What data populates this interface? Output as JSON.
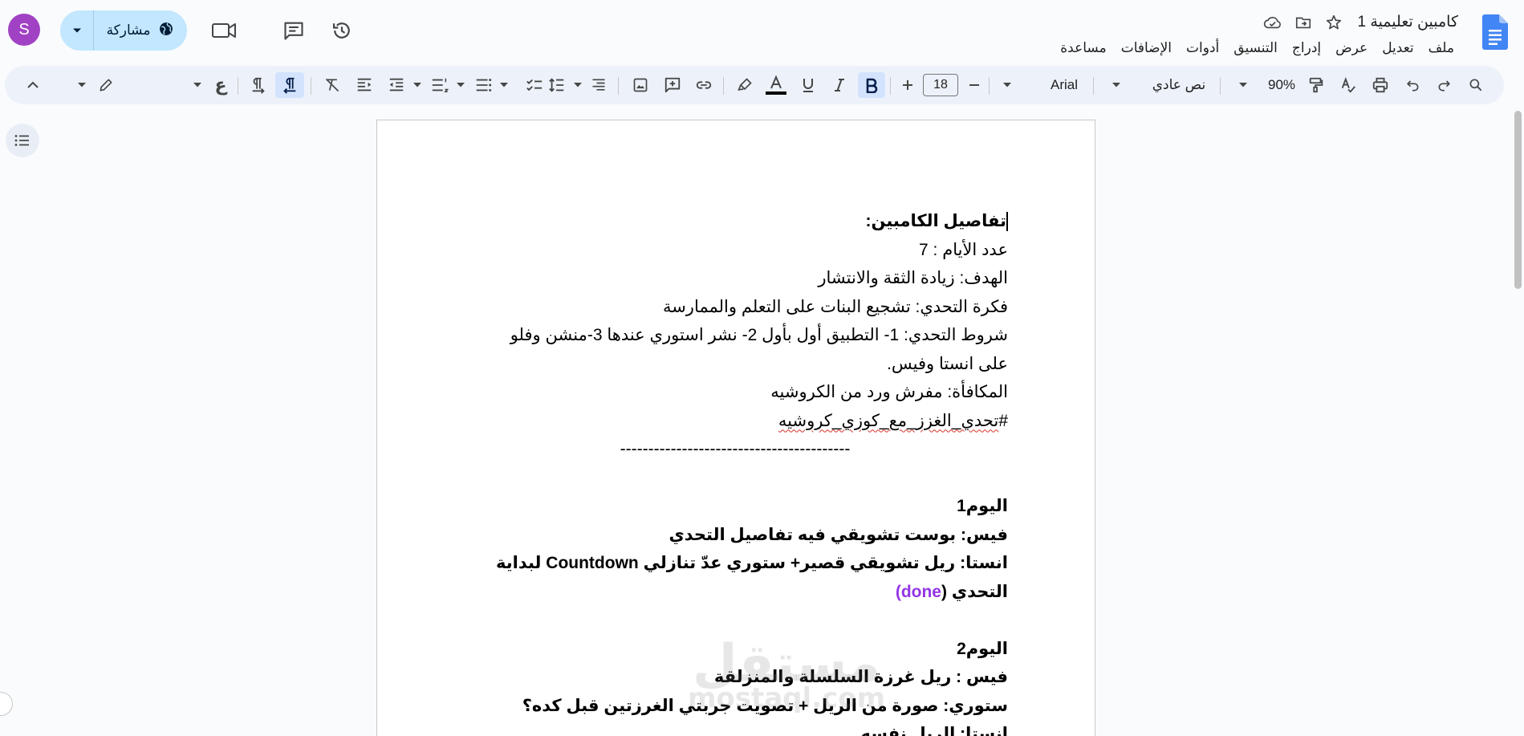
{
  "doc": {
    "title": "كامبين تعليمية 1",
    "menus": [
      "ملف",
      "تعديل",
      "عرض",
      "إدراج",
      "التنسيق",
      "أدوات",
      "الإضافات",
      "مساعدة"
    ]
  },
  "header": {
    "avatar_letter": "S",
    "share_label": "مشاركة"
  },
  "toolbar": {
    "zoom": "90%",
    "style": "نص عادي",
    "font": "Arial",
    "font_size": "18",
    "ain_glyph": "ع"
  },
  "content": {
    "heading": "تفاصيل الكامبين:",
    "days": "عدد الأيام : 7",
    "goal": "الهدف: زيادة الثقة والانتشار",
    "idea": "فكرة التحدي: تشجيع البنات على التعلم والممارسة",
    "conditions_1": "شروط التحدي: 1- التطبيق أول بأول 2- نشر استوري عندها 3-منشن وفلو",
    "conditions_2": "على انستا وفيس.",
    "reward": "المكافأة: مفرش ورد من الكروشيه",
    "hashtag_hash": "#",
    "hashtag_text": "تحدي_الغزز_مع_كوزي_كروشيه",
    "divider": "-----------------------------------------",
    "day1_title": "اليوم1",
    "day1_fb": "فيس: بوست تشويقي فيه تفاصيل التحدي",
    "day1_insta_1": "انستا: ريل تشويقي قصير+ ستوري عدّ تنازلي Countdown لبداية",
    "day1_insta_2a": "التحدي (",
    "day1_insta_2b": "done)",
    "day2_title": "اليوم2",
    "day2_fb": "فيس : ريل غرزة السلسلة والمنزلقة",
    "day2_story": "ستوري: صورة من الريل + تصويت جربتي الغرزتين قبل كده؟",
    "day2_insta": "انستا: الريل نفسه"
  },
  "watermark": {
    "arabic": "مستقل",
    "latin": "mostaql.com"
  }
}
